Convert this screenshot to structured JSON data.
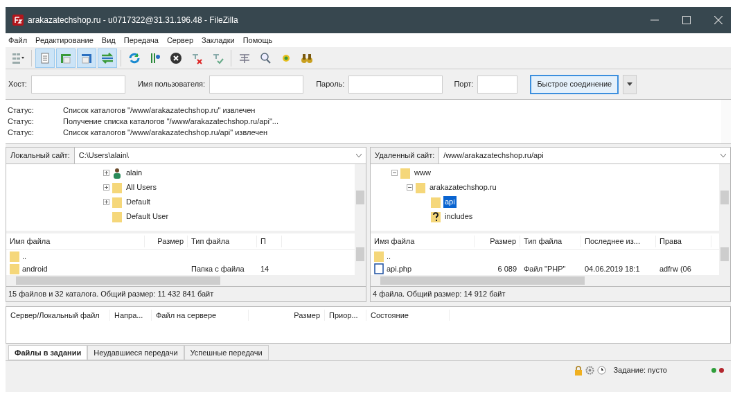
{
  "window": {
    "title": "arakazatechshop.ru - u0717322@31.31.196.48 - FileZilla"
  },
  "menu": [
    "Файл",
    "Редактирование",
    "Вид",
    "Передача",
    "Сервер",
    "Закладки",
    "Помощь"
  ],
  "toolbar": [
    {
      "kind": "site-manager",
      "selected": false
    },
    {
      "kind": "log",
      "selected": true
    },
    {
      "kind": "local-tree",
      "selected": true
    },
    {
      "kind": "remote-tree",
      "selected": true
    },
    {
      "kind": "queue",
      "selected": true
    },
    {
      "kind": "refresh",
      "selected": false
    },
    {
      "kind": "process",
      "selected": false
    },
    {
      "kind": "cancel",
      "selected": false
    },
    {
      "kind": "disconnect",
      "selected": false
    },
    {
      "kind": "reconnect",
      "selected": false
    },
    {
      "kind": "filter",
      "selected": false
    },
    {
      "kind": "find",
      "selected": false
    },
    {
      "kind": "sync",
      "selected": false
    },
    {
      "kind": "search",
      "selected": false
    }
  ],
  "quickconnect": {
    "host_label": "Хост:",
    "user_label": "Имя пользователя:",
    "password_label": "Пароль:",
    "port_label": "Порт:",
    "button": "Быстрое соединение"
  },
  "log": [
    {
      "label": "Статус:",
      "message": "Список каталогов \"/www/arakazatechshop.ru\" извлечен"
    },
    {
      "label": "Статус:",
      "message": "Получение списка каталогов \"/www/arakazatechshop.ru/api\"..."
    },
    {
      "label": "Статус:",
      "message": "Список каталогов \"/www/arakazatechshop.ru/api\" извлечен"
    }
  ],
  "local": {
    "site_label": "Локальный сайт:",
    "path": "C:\\Users\\alain\\",
    "tree": [
      {
        "name": "alain",
        "kind": "user",
        "expanded": false,
        "selected": false
      },
      {
        "name": "All Users",
        "kind": "folder",
        "expanded": false,
        "selected": false
      },
      {
        "name": "Default",
        "kind": "folder",
        "expanded": false,
        "selected": false
      },
      {
        "name": "Default User",
        "kind": "folder",
        "selected": false
      }
    ],
    "columns": [
      "Имя файла",
      "Размер",
      "Тип файла",
      "П"
    ],
    "rows": [
      {
        "kind": "folder",
        "cells": [
          "..",
          "",
          "",
          ""
        ]
      },
      {
        "kind": "folder",
        "cells": [
          "android",
          "",
          "Папка с файла",
          "14"
        ]
      }
    ],
    "summary": "15 файлов и 32 каталога. Общий размер: 11 432 841 байт"
  },
  "remote": {
    "site_label": "Удаленный сайт:",
    "path": "/www/arakazatechshop.ru/api",
    "tree": [
      {
        "name": "www",
        "kind": "folder",
        "expanded": true,
        "selected": false,
        "children": [
          {
            "name": "arakazatechshop.ru",
            "kind": "folder",
            "expanded": true,
            "selected": false,
            "children": [
              {
                "name": "api",
                "kind": "folder",
                "selected": true
              },
              {
                "name": "includes",
                "kind": "unknown",
                "selected": false
              }
            ]
          }
        ]
      }
    ],
    "columns": [
      "Имя файла",
      "Размер",
      "Тип файла",
      "Последнее из...",
      "Права"
    ],
    "rows": [
      {
        "kind": "folder",
        "cells": [
          "..",
          "",
          "",
          "",
          ""
        ]
      },
      {
        "kind": "file",
        "cells": [
          "api.php",
          "6 089",
          "Файл \"PHP\"",
          "04.06.2019 18:1",
          "adfrw (06"
        ]
      }
    ],
    "summary": "4 файла. Общий размер: 14 912 байт"
  },
  "queue": {
    "columns": [
      "Сервер/Локальный файл",
      "Напра...",
      "Файл на сервере",
      "Размер",
      "Приор...",
      "Состояние"
    ],
    "tabs": [
      {
        "label": "Файлы в задании",
        "selected": true
      },
      {
        "label": "Неудавшиеся передачи",
        "selected": false
      },
      {
        "label": "Успешные передачи",
        "selected": false
      }
    ]
  },
  "status": {
    "queue_text": "Задание: пусто",
    "lights": [
      {
        "color": "#2f9e3a"
      },
      {
        "color": "#b3262e"
      }
    ]
  }
}
